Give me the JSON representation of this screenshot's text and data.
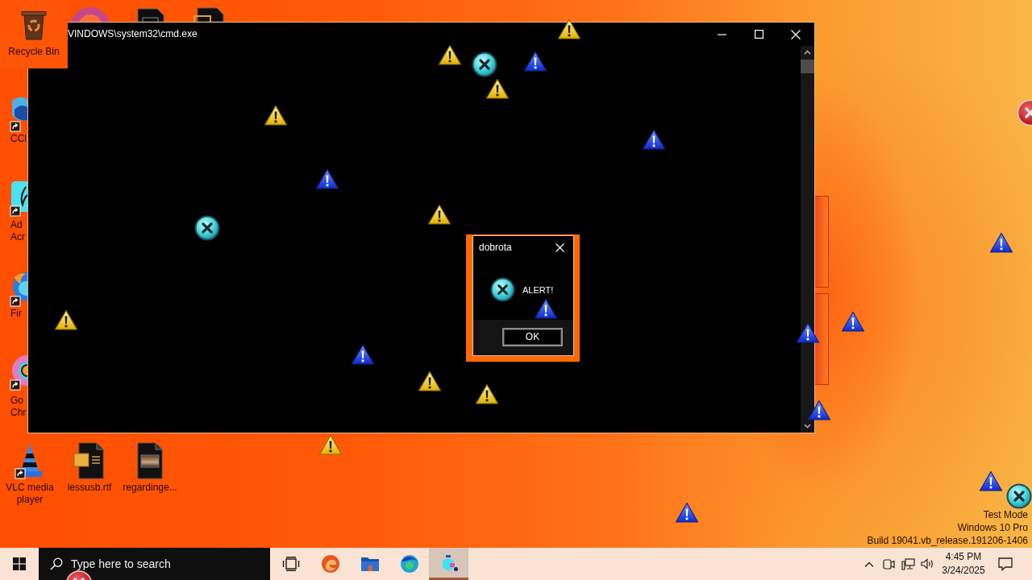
{
  "desktop": {
    "icons": [
      {
        "label": "Recycle Bin"
      },
      {
        "label": "CCl"
      },
      {
        "label": "Ad Acr"
      },
      {
        "label": "Fir"
      },
      {
        "label": "Go Chr"
      },
      {
        "label": "VLC media player"
      },
      {
        "label": "lessusb.rtf"
      },
      {
        "label": "regardinge..."
      }
    ],
    "system_info": [
      "Test Mode",
      "Windows 10 Pro",
      "Build 19041.vb_release.191206-1406"
    ]
  },
  "terminal_window": {
    "title": "VINDOWS\\system32\\cmd.exe"
  },
  "dialog": {
    "title": "dobrota",
    "message": "ALERT!",
    "button": "OK"
  },
  "taskbar": {
    "search": {
      "placeholder": "Type here to search"
    },
    "apps": [
      {
        "selected": false
      },
      {
        "selected": false
      },
      {
        "selected": false
      },
      {
        "selected": true
      }
    ],
    "clock": {
      "time": "4:45 PM",
      "date": "3/24/2025"
    }
  }
}
